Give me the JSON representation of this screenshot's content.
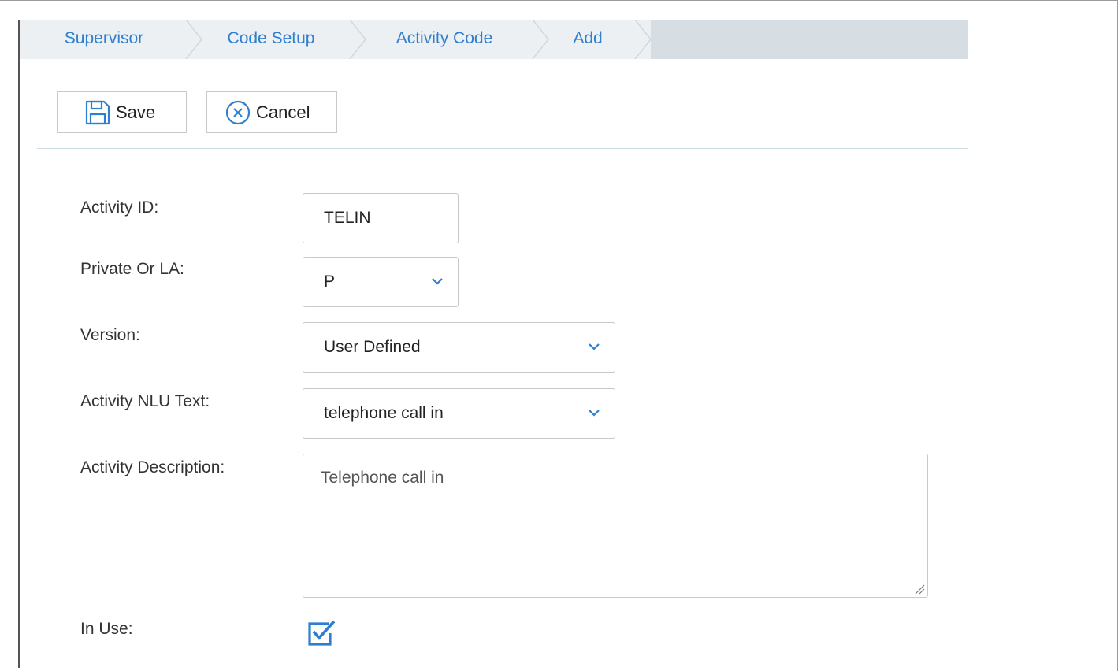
{
  "breadcrumb": {
    "items": [
      {
        "label": "Supervisor"
      },
      {
        "label": "Code Setup"
      },
      {
        "label": "Activity Code"
      },
      {
        "label": "Add"
      }
    ]
  },
  "toolbar": {
    "save_label": "Save",
    "save_icon": "floppy-disk-icon",
    "cancel_label": "Cancel",
    "cancel_icon": "circle-x-icon"
  },
  "form": {
    "activity_id": {
      "label": "Activity ID:",
      "value": "TELIN"
    },
    "private_or_la": {
      "label": "Private Or LA:",
      "value": "P"
    },
    "version": {
      "label": "Version:",
      "value": "User Defined"
    },
    "nlu_text": {
      "label": "Activity NLU Text:",
      "value": "telephone call in"
    },
    "description": {
      "label": "Activity Description:",
      "value": "Telephone call in"
    },
    "in_use": {
      "label": "In Use:",
      "checked": true
    }
  },
  "colors": {
    "accent": "#2f7fcf",
    "breadcrumb_bg": "#edf0f2",
    "breadcrumb_tail": "#d6dde3"
  }
}
